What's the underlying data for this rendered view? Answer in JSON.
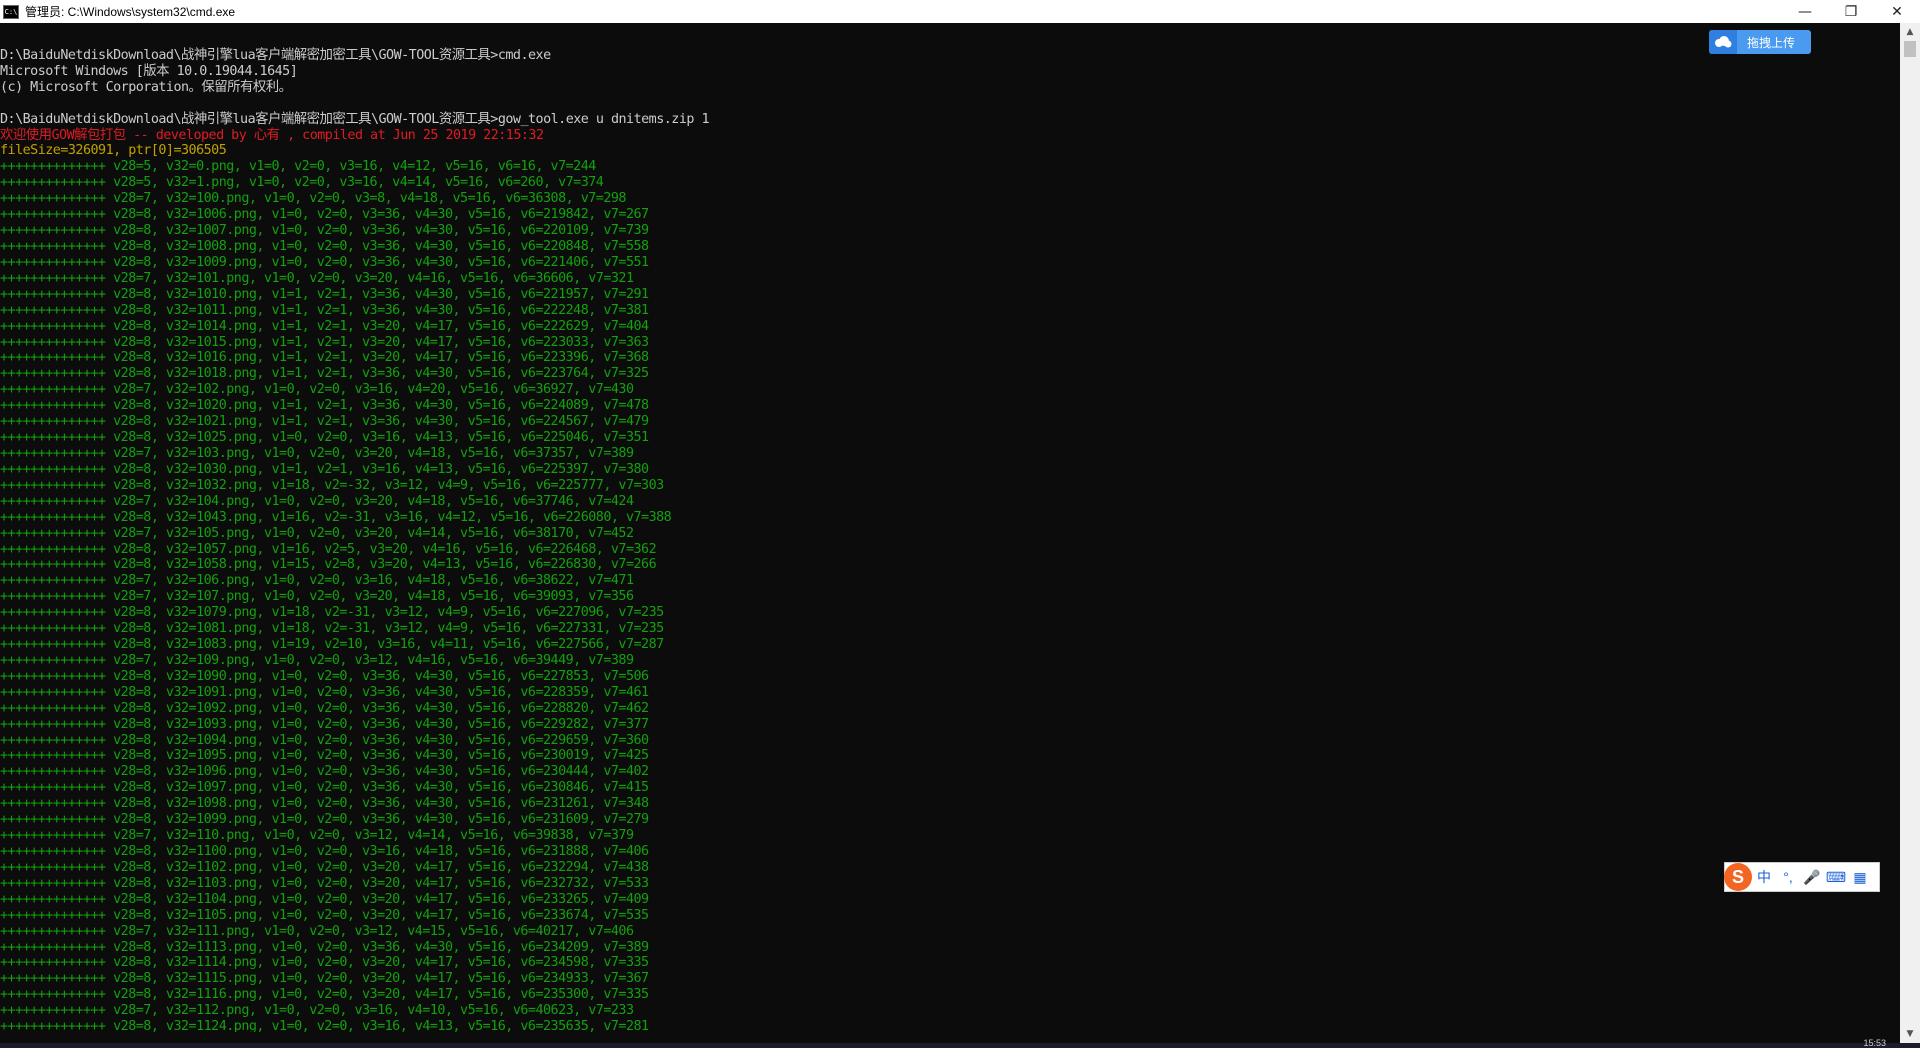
{
  "window": {
    "title": "管理员: C:\\Windows\\system32\\cmd.exe",
    "icon_text": "C:\\",
    "minimize_glyph": "—",
    "maximize_glyph": "❐",
    "close_glyph": "✕"
  },
  "overlay": {
    "upload_label": "拖拽上传",
    "ime_chars": [
      "中",
      "°,",
      "🎤",
      "⌨",
      "▦"
    ],
    "ime_logo": "S",
    "clock_peek": "15:53"
  },
  "scrollbar": {
    "up": "▲",
    "down": "▼"
  },
  "console_lines": [
    {
      "c": "gray",
      "t": ""
    },
    {
      "c": "gray",
      "t": "D:\\BaiduNetdiskDownload\\战神引擎lua客户端解密加密工具\\GOW-TOOL资源工具>cmd.exe"
    },
    {
      "c": "gray",
      "t": "Microsoft Windows [版本 10.0.19044.1645]"
    },
    {
      "c": "gray",
      "t": "(c) Microsoft Corporation。保留所有权利。"
    },
    {
      "c": "gray",
      "t": ""
    },
    {
      "c": "gray",
      "t": "D:\\BaiduNetdiskDownload\\战神引擎lua客户端解密加密工具\\GOW-TOOL资源工具>gow_tool.exe u dnitems.zip 1"
    },
    {
      "c": "red",
      "t": "欢迎使用GOW解包打包 -- developed by 心有 , compiled at Jun 25 2019 22:15:32"
    },
    {
      "c": "yellow",
      "t": "fileSize=326091, ptr[0]=306505"
    },
    {
      "c": "green",
      "t": "++++++++++++++ v28=5, v32=0.png, v1=0, v2=0, v3=16, v4=12, v5=16, v6=16, v7=244"
    },
    {
      "c": "green",
      "t": "++++++++++++++ v28=5, v32=1.png, v1=0, v2=0, v3=16, v4=14, v5=16, v6=260, v7=374"
    },
    {
      "c": "green",
      "t": "++++++++++++++ v28=7, v32=100.png, v1=0, v2=0, v3=8, v4=18, v5=16, v6=36308, v7=298"
    },
    {
      "c": "green",
      "t": "++++++++++++++ v28=8, v32=1006.png, v1=0, v2=0, v3=36, v4=30, v5=16, v6=219842, v7=267"
    },
    {
      "c": "green",
      "t": "++++++++++++++ v28=8, v32=1007.png, v1=0, v2=0, v3=36, v4=30, v5=16, v6=220109, v7=739"
    },
    {
      "c": "green",
      "t": "++++++++++++++ v28=8, v32=1008.png, v1=0, v2=0, v3=36, v4=30, v5=16, v6=220848, v7=558"
    },
    {
      "c": "green",
      "t": "++++++++++++++ v28=8, v32=1009.png, v1=0, v2=0, v3=36, v4=30, v5=16, v6=221406, v7=551"
    },
    {
      "c": "green",
      "t": "++++++++++++++ v28=7, v32=101.png, v1=0, v2=0, v3=20, v4=16, v5=16, v6=36606, v7=321"
    },
    {
      "c": "green",
      "t": "++++++++++++++ v28=8, v32=1010.png, v1=1, v2=1, v3=36, v4=30, v5=16, v6=221957, v7=291"
    },
    {
      "c": "green",
      "t": "++++++++++++++ v28=8, v32=1011.png, v1=1, v2=1, v3=36, v4=30, v5=16, v6=222248, v7=381"
    },
    {
      "c": "green",
      "t": "++++++++++++++ v28=8, v32=1014.png, v1=1, v2=1, v3=20, v4=17, v5=16, v6=222629, v7=404"
    },
    {
      "c": "green",
      "t": "++++++++++++++ v28=8, v32=1015.png, v1=1, v2=1, v3=20, v4=17, v5=16, v6=223033, v7=363"
    },
    {
      "c": "green",
      "t": "++++++++++++++ v28=8, v32=1016.png, v1=1, v2=1, v3=20, v4=17, v5=16, v6=223396, v7=368"
    },
    {
      "c": "green",
      "t": "++++++++++++++ v28=8, v32=1018.png, v1=1, v2=1, v3=36, v4=30, v5=16, v6=223764, v7=325"
    },
    {
      "c": "green",
      "t": "++++++++++++++ v28=7, v32=102.png, v1=0, v2=0, v3=16, v4=20, v5=16, v6=36927, v7=430"
    },
    {
      "c": "green",
      "t": "++++++++++++++ v28=8, v32=1020.png, v1=1, v2=1, v3=36, v4=30, v5=16, v6=224089, v7=478"
    },
    {
      "c": "green",
      "t": "++++++++++++++ v28=8, v32=1021.png, v1=1, v2=1, v3=36, v4=30, v5=16, v6=224567, v7=479"
    },
    {
      "c": "green",
      "t": "++++++++++++++ v28=8, v32=1025.png, v1=0, v2=0, v3=16, v4=13, v5=16, v6=225046, v7=351"
    },
    {
      "c": "green",
      "t": "++++++++++++++ v28=7, v32=103.png, v1=0, v2=0, v3=20, v4=18, v5=16, v6=37357, v7=389"
    },
    {
      "c": "green",
      "t": "++++++++++++++ v28=8, v32=1030.png, v1=1, v2=1, v3=16, v4=13, v5=16, v6=225397, v7=380"
    },
    {
      "c": "green",
      "t": "++++++++++++++ v28=8, v32=1032.png, v1=18, v2=-32, v3=12, v4=9, v5=16, v6=225777, v7=303"
    },
    {
      "c": "green",
      "t": "++++++++++++++ v28=7, v32=104.png, v1=0, v2=0, v3=20, v4=18, v5=16, v6=37746, v7=424"
    },
    {
      "c": "green",
      "t": "++++++++++++++ v28=8, v32=1043.png, v1=16, v2=-31, v3=16, v4=12, v5=16, v6=226080, v7=388"
    },
    {
      "c": "green",
      "t": "++++++++++++++ v28=7, v32=105.png, v1=0, v2=0, v3=20, v4=14, v5=16, v6=38170, v7=452"
    },
    {
      "c": "green",
      "t": "++++++++++++++ v28=8, v32=1057.png, v1=16, v2=5, v3=20, v4=16, v5=16, v6=226468, v7=362"
    },
    {
      "c": "green",
      "t": "++++++++++++++ v28=8, v32=1058.png, v1=15, v2=8, v3=20, v4=13, v5=16, v6=226830, v7=266"
    },
    {
      "c": "green",
      "t": "++++++++++++++ v28=7, v32=106.png, v1=0, v2=0, v3=16, v4=18, v5=16, v6=38622, v7=471"
    },
    {
      "c": "green",
      "t": "++++++++++++++ v28=7, v32=107.png, v1=0, v2=0, v3=20, v4=18, v5=16, v6=39093, v7=356"
    },
    {
      "c": "green",
      "t": "++++++++++++++ v28=8, v32=1079.png, v1=18, v2=-31, v3=12, v4=9, v5=16, v6=227096, v7=235"
    },
    {
      "c": "green",
      "t": "++++++++++++++ v28=8, v32=1081.png, v1=18, v2=-31, v3=12, v4=9, v5=16, v6=227331, v7=235"
    },
    {
      "c": "green",
      "t": "++++++++++++++ v28=8, v32=1083.png, v1=19, v2=10, v3=16, v4=11, v5=16, v6=227566, v7=287"
    },
    {
      "c": "green",
      "t": "++++++++++++++ v28=7, v32=109.png, v1=0, v2=0, v3=12, v4=16, v5=16, v6=39449, v7=389"
    },
    {
      "c": "green",
      "t": "++++++++++++++ v28=8, v32=1090.png, v1=0, v2=0, v3=36, v4=30, v5=16, v6=227853, v7=506"
    },
    {
      "c": "green",
      "t": "++++++++++++++ v28=8, v32=1091.png, v1=0, v2=0, v3=36, v4=30, v5=16, v6=228359, v7=461"
    },
    {
      "c": "green",
      "t": "++++++++++++++ v28=8, v32=1092.png, v1=0, v2=0, v3=36, v4=30, v5=16, v6=228820, v7=462"
    },
    {
      "c": "green",
      "t": "++++++++++++++ v28=8, v32=1093.png, v1=0, v2=0, v3=36, v4=30, v5=16, v6=229282, v7=377"
    },
    {
      "c": "green",
      "t": "++++++++++++++ v28=8, v32=1094.png, v1=0, v2=0, v3=36, v4=30, v5=16, v6=229659, v7=360"
    },
    {
      "c": "green",
      "t": "++++++++++++++ v28=8, v32=1095.png, v1=0, v2=0, v3=36, v4=30, v5=16, v6=230019, v7=425"
    },
    {
      "c": "green",
      "t": "++++++++++++++ v28=8, v32=1096.png, v1=0, v2=0, v3=36, v4=30, v5=16, v6=230444, v7=402"
    },
    {
      "c": "green",
      "t": "++++++++++++++ v28=8, v32=1097.png, v1=0, v2=0, v3=36, v4=30, v5=16, v6=230846, v7=415"
    },
    {
      "c": "green",
      "t": "++++++++++++++ v28=8, v32=1098.png, v1=0, v2=0, v3=36, v4=30, v5=16, v6=231261, v7=348"
    },
    {
      "c": "green",
      "t": "++++++++++++++ v28=8, v32=1099.png, v1=0, v2=0, v3=36, v4=30, v5=16, v6=231609, v7=279"
    },
    {
      "c": "green",
      "t": "++++++++++++++ v28=7, v32=110.png, v1=0, v2=0, v3=12, v4=14, v5=16, v6=39838, v7=379"
    },
    {
      "c": "green",
      "t": "++++++++++++++ v28=8, v32=1100.png, v1=0, v2=0, v3=16, v4=18, v5=16, v6=231888, v7=406"
    },
    {
      "c": "green",
      "t": "++++++++++++++ v28=8, v32=1102.png, v1=0, v2=0, v3=20, v4=17, v5=16, v6=232294, v7=438"
    },
    {
      "c": "green",
      "t": "++++++++++++++ v28=8, v32=1103.png, v1=0, v2=0, v3=20, v4=17, v5=16, v6=232732, v7=533"
    },
    {
      "c": "green",
      "t": "++++++++++++++ v28=8, v32=1104.png, v1=0, v2=0, v3=20, v4=17, v5=16, v6=233265, v7=409"
    },
    {
      "c": "green",
      "t": "++++++++++++++ v28=8, v32=1105.png, v1=0, v2=0, v3=20, v4=17, v5=16, v6=233674, v7=535"
    },
    {
      "c": "green",
      "t": "++++++++++++++ v28=7, v32=111.png, v1=0, v2=0, v3=12, v4=15, v5=16, v6=40217, v7=406"
    },
    {
      "c": "green",
      "t": "++++++++++++++ v28=8, v32=1113.png, v1=0, v2=0, v3=36, v4=30, v5=16, v6=234209, v7=389"
    },
    {
      "c": "green",
      "t": "++++++++++++++ v28=8, v32=1114.png, v1=0, v2=0, v3=20, v4=17, v5=16, v6=234598, v7=335"
    },
    {
      "c": "green",
      "t": "++++++++++++++ v28=8, v32=1115.png, v1=0, v2=0, v3=20, v4=17, v5=16, v6=234933, v7=367"
    },
    {
      "c": "green",
      "t": "++++++++++++++ v28=8, v32=1116.png, v1=0, v2=0, v3=20, v4=17, v5=16, v6=235300, v7=335"
    },
    {
      "c": "green",
      "t": "++++++++++++++ v28=7, v32=112.png, v1=0, v2=0, v3=16, v4=10, v5=16, v6=40623, v7=233"
    },
    {
      "c": "green",
      "t": "++++++++++++++ v28=8, v32=1124.png, v1=0, v2=0, v3=16, v4=13, v5=16, v6=235635, v7=281"
    }
  ]
}
